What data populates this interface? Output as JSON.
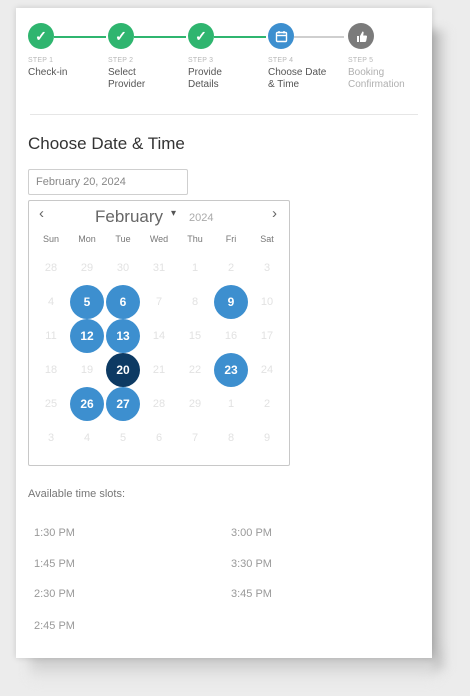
{
  "stepper": {
    "steps": [
      {
        "number": "STEP 1",
        "label": "Check-in",
        "status": "done"
      },
      {
        "number": "STEP 2",
        "label": "Select Provider",
        "status": "done"
      },
      {
        "number": "STEP 3",
        "label": "Provide Details",
        "status": "done"
      },
      {
        "number": "STEP 4",
        "label": "Choose Date & Time",
        "status": "current"
      },
      {
        "number": "STEP 5",
        "label": "Booking Confirmation",
        "status": "pending"
      }
    ]
  },
  "heading": "Choose Date & Time",
  "date_input": {
    "value": "February 20, 2024"
  },
  "calendar": {
    "prev_icon": "‹",
    "next_icon": "›",
    "month": "February",
    "caret": "▾",
    "year": "2024",
    "weekdays": [
      "Sun",
      "Mon",
      "Tue",
      "Wed",
      "Thu",
      "Fri",
      "Sat"
    ],
    "days": [
      [
        "28",
        "29",
        "30",
        "31",
        "1",
        "2",
        "3"
      ],
      [
        "4",
        "5",
        "6",
        "7",
        "8",
        "9",
        "10"
      ],
      [
        "11",
        "12",
        "13",
        "14",
        "15",
        "16",
        "17"
      ],
      [
        "18",
        "19",
        "20",
        "21",
        "22",
        "23",
        "24"
      ],
      [
        "25",
        "26",
        "27",
        "28",
        "29",
        "1",
        "2"
      ],
      [
        "3",
        "4",
        "5",
        "6",
        "7",
        "8",
        "9"
      ]
    ],
    "available": [
      "5",
      "6",
      "9",
      "12",
      "13",
      "23",
      "26",
      "27"
    ],
    "selected": "20"
  },
  "slots": {
    "title": "Available time slots:",
    "left": [
      "1:30 PM",
      "1:45 PM",
      "2:30 PM",
      "2:45 PM"
    ],
    "right": [
      "3:00 PM",
      "3:30 PM",
      "3:45 PM"
    ]
  },
  "colors": {
    "done": "#2fb56f",
    "current": "#3d8fcf",
    "available": "#3d8fcf",
    "selected": "#0d3a63"
  }
}
